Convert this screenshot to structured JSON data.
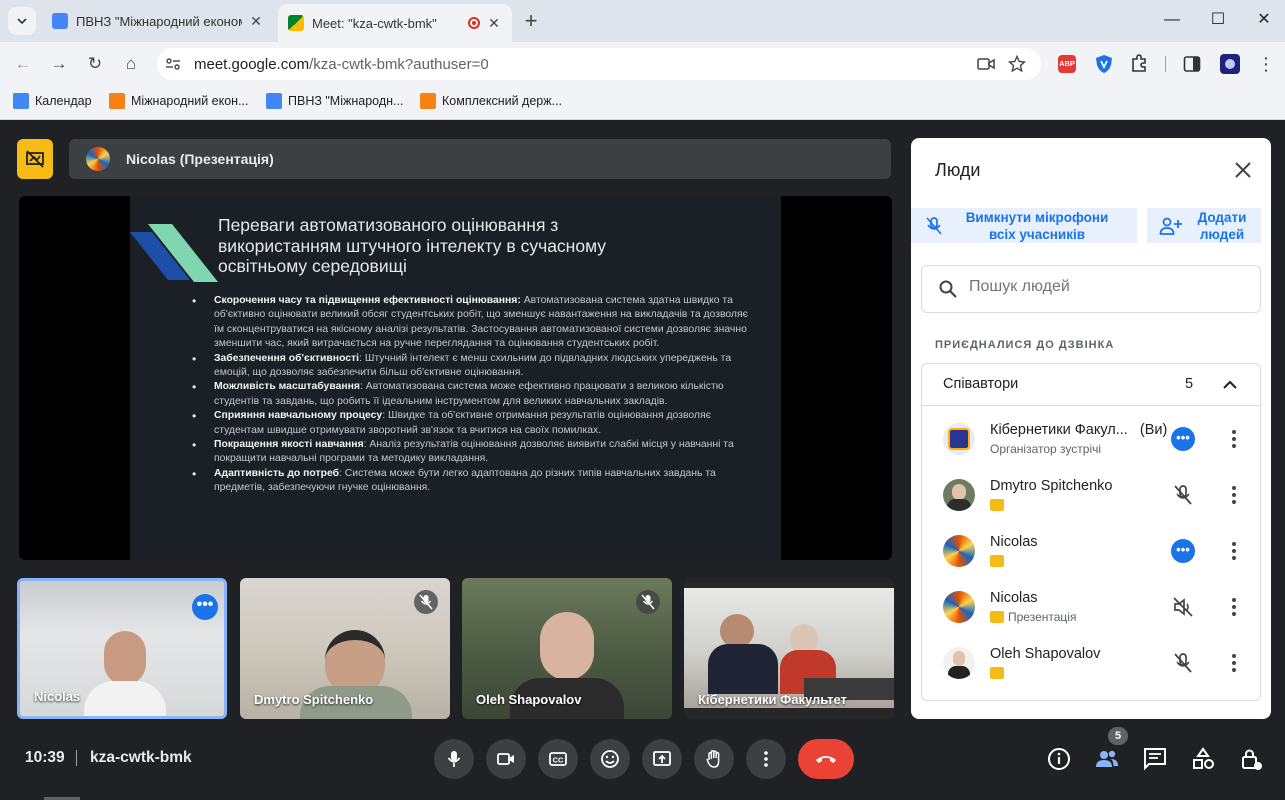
{
  "browser": {
    "tabs": [
      {
        "title": "ПВНЗ \"Міжнародний економі",
        "active": false
      },
      {
        "title": "Meet: \"kza-cwtk-bmk\"",
        "active": true
      }
    ],
    "url_host": "meet.google.com",
    "url_path": "/kza-cwtk-bmk?authuser=0",
    "bookmarks": [
      "Календар",
      "Міжнародний екон...",
      "ПВНЗ \"Міжнародн...",
      "Комплексний держ..."
    ],
    "extension_labels": [
      "ABP"
    ]
  },
  "meet": {
    "presenter_label": "Nicolas (Презентація)",
    "slide": {
      "title": "Переваги автоматизованого оцінювання з використанням штучного інтелекту в сучасному освітньому середовищі",
      "bullets": [
        {
          "head": "Скорочення часу та підвищення ефективності оцінювання:",
          "text": " Автоматизована система здатна швидко та об'єктивно оцінювати великий обсяг студентських робіт, що зменшує навантаження на викладачів та дозволяє їм сконцентруватися на якісному аналізі результатів. Застосування автоматизованої системи дозволяє значно зменшити час, який витрачається на ручне переглядання та оцінювання студентських робіт."
        },
        {
          "head": "Забезпечення об'єктивності",
          "text": ": Штучний інтелект є менш схильним до підвладних людських упереджень та емоцій, що дозволяє забезпечити більш об'єктивне оцінювання."
        },
        {
          "head": "Можливість масштабування",
          "text": ": Автоматизована система може ефективно працювати з великою кількістю студентів та завдань, що робить її ідеальним інструментом для великих навчальних закладів."
        },
        {
          "head": "Сприяння навчальному процесу",
          "text": ": Швидке та об'єктивне отримання результатів оцінювання дозволяє студентам швидше отримувати зворотний зв'язок та вчитися на своїх помилках."
        },
        {
          "head": "Покращення якості навчання",
          "text": ": Аналіз результатів оцінювання дозволяє виявити слабкі місця у навчанні та покращити навчальні програми та методику викладання."
        },
        {
          "head": "Адаптивність до потреб",
          "text": ": Система може бути легко адаптована до різних типів навчальних завдань та предметів, забезпечуючи гнучке оцінювання."
        }
      ]
    },
    "tiles": [
      {
        "name": "Nicolas",
        "muted": false
      },
      {
        "name": "Dmytro Spitchenko",
        "muted": true
      },
      {
        "name": "Oleh Shapovalov",
        "muted": true
      },
      {
        "name": "Кібернетики Факультет",
        "muted": false
      }
    ],
    "clock": "10:39",
    "meeting_code": "kza-cwtk-bmk",
    "participant_count": "5"
  },
  "people": {
    "title": "Люди",
    "mute_all_label": "Вимкнути мікрофони всіх учасників",
    "add_people_label": "Додати людей",
    "search_placeholder": "Пошук людей",
    "section_label": "ПРИЄДНАЛИСЯ ДО ДЗВІНКА",
    "group_label": "Співавтори",
    "group_count": "5",
    "participants": [
      {
        "name": "Кібернетики Факул...",
        "suffix": "(Ви)",
        "sub": "Організатор зустрічі",
        "status": "speaking"
      },
      {
        "name": "Dmytro Spitchenko",
        "suffix": "",
        "sub": "",
        "status": "muted"
      },
      {
        "name": "Nicolas",
        "suffix": "",
        "sub": "",
        "status": "speaking"
      },
      {
        "name": "Nicolas",
        "suffix": "",
        "sub": "Презентація",
        "status": "presentation"
      },
      {
        "name": "Oleh Shapovalov",
        "suffix": "",
        "sub": "",
        "status": "muted"
      }
    ]
  },
  "colors": {
    "accent": "#1a73e8",
    "hangup": "#ea4335",
    "presenter": "#f6bb14",
    "meet_bg": "#202124"
  }
}
